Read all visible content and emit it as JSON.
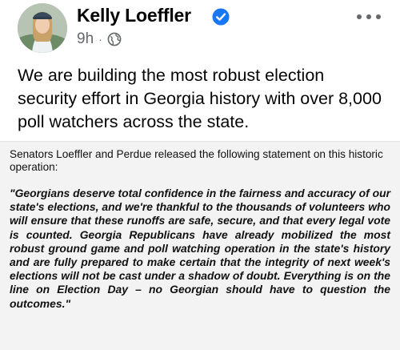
{
  "post": {
    "author_name": "Kelly Loeffler",
    "verified": true,
    "timestamp": "9h",
    "separator": "·",
    "audience_icon": "globe-icon",
    "more_icon": "more-options-icon",
    "text": "We are building the most robust election security effort in Georgia history with over 8,000 poll watchers across the state."
  },
  "statement": {
    "intro": "Senators Loeffler and Perdue released the following statement on this historic operation:",
    "quote": "\"Georgians deserve total confidence in the fairness and accuracy of our state's elections, and we're thankful to the thousands of volunteers who will ensure that these runoffs are safe, secure, and that every legal vote is counted. Georgia Republicans have already mobilized the most robust ground game and poll watching operation in the state's history and are fully prepared to make certain that the integrity of next week's elections will not be cast under a shadow of doubt. Everything is on the line on Election Day – no Georgian should have to question the outcomes.\""
  },
  "colors": {
    "verified_blue": "#1877f2",
    "meta_gray": "#65676b",
    "card_background": "#f3f3f3"
  }
}
